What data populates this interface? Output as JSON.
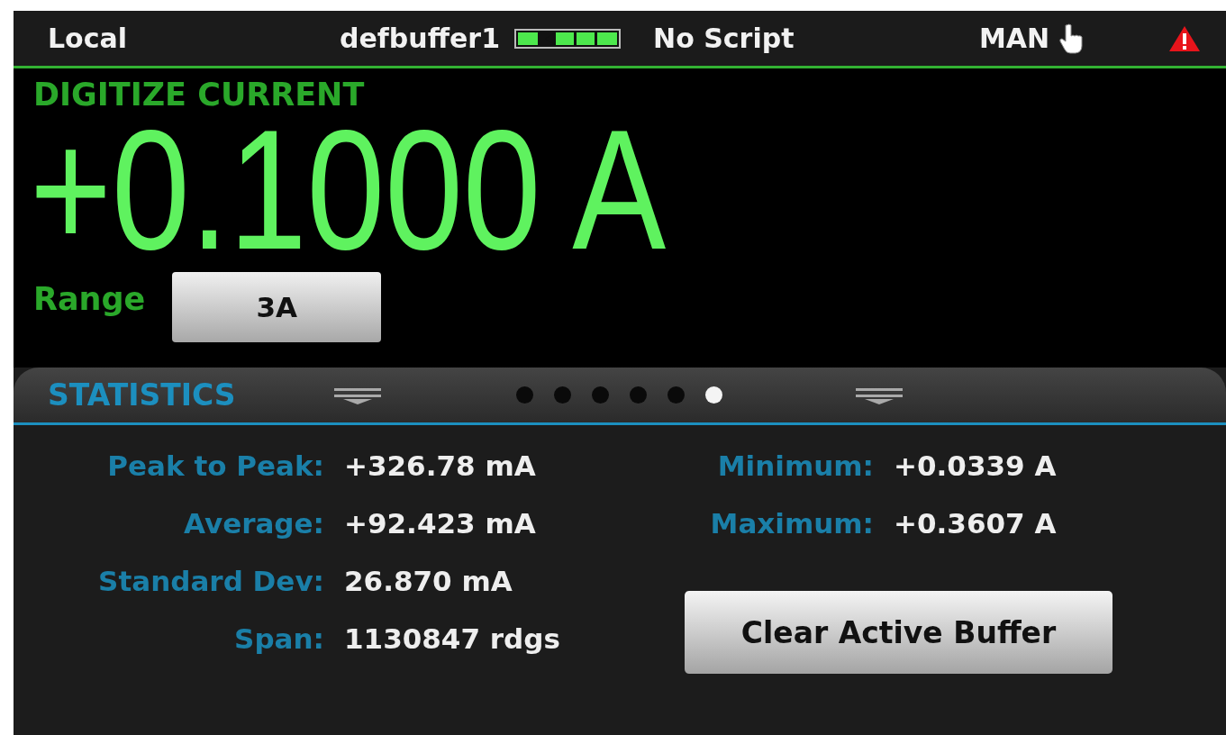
{
  "status_bar": {
    "mode": "Local",
    "buffer": "defbuffer1",
    "script": "No Script",
    "trigger": "MAN",
    "alert": true
  },
  "measurement": {
    "function": "DIGITIZE CURRENT",
    "reading": "+0.1000 A",
    "range_label": "Range",
    "range_value": "3A"
  },
  "panel": {
    "title": "STATISTICS",
    "pages": [
      {
        "selected": false
      },
      {
        "selected": false
      },
      {
        "selected": false
      },
      {
        "selected": false
      },
      {
        "selected": false
      },
      {
        "selected": true
      }
    ],
    "left_stats": [
      {
        "label": "Peak to Peak:",
        "value": "+326.78 mA"
      },
      {
        "label": "Average:",
        "value": "+92.423 mA"
      },
      {
        "label": "Standard Dev:",
        "value": "26.870 mA"
      },
      {
        "label": "Span:",
        "value": "1130847 rdgs"
      }
    ],
    "right_stats": [
      {
        "label": "Minimum:",
        "value": "+0.0339 A"
      },
      {
        "label": "Maximum:",
        "value": "+0.3607 A"
      }
    ],
    "button": "Clear Active Buffer"
  }
}
